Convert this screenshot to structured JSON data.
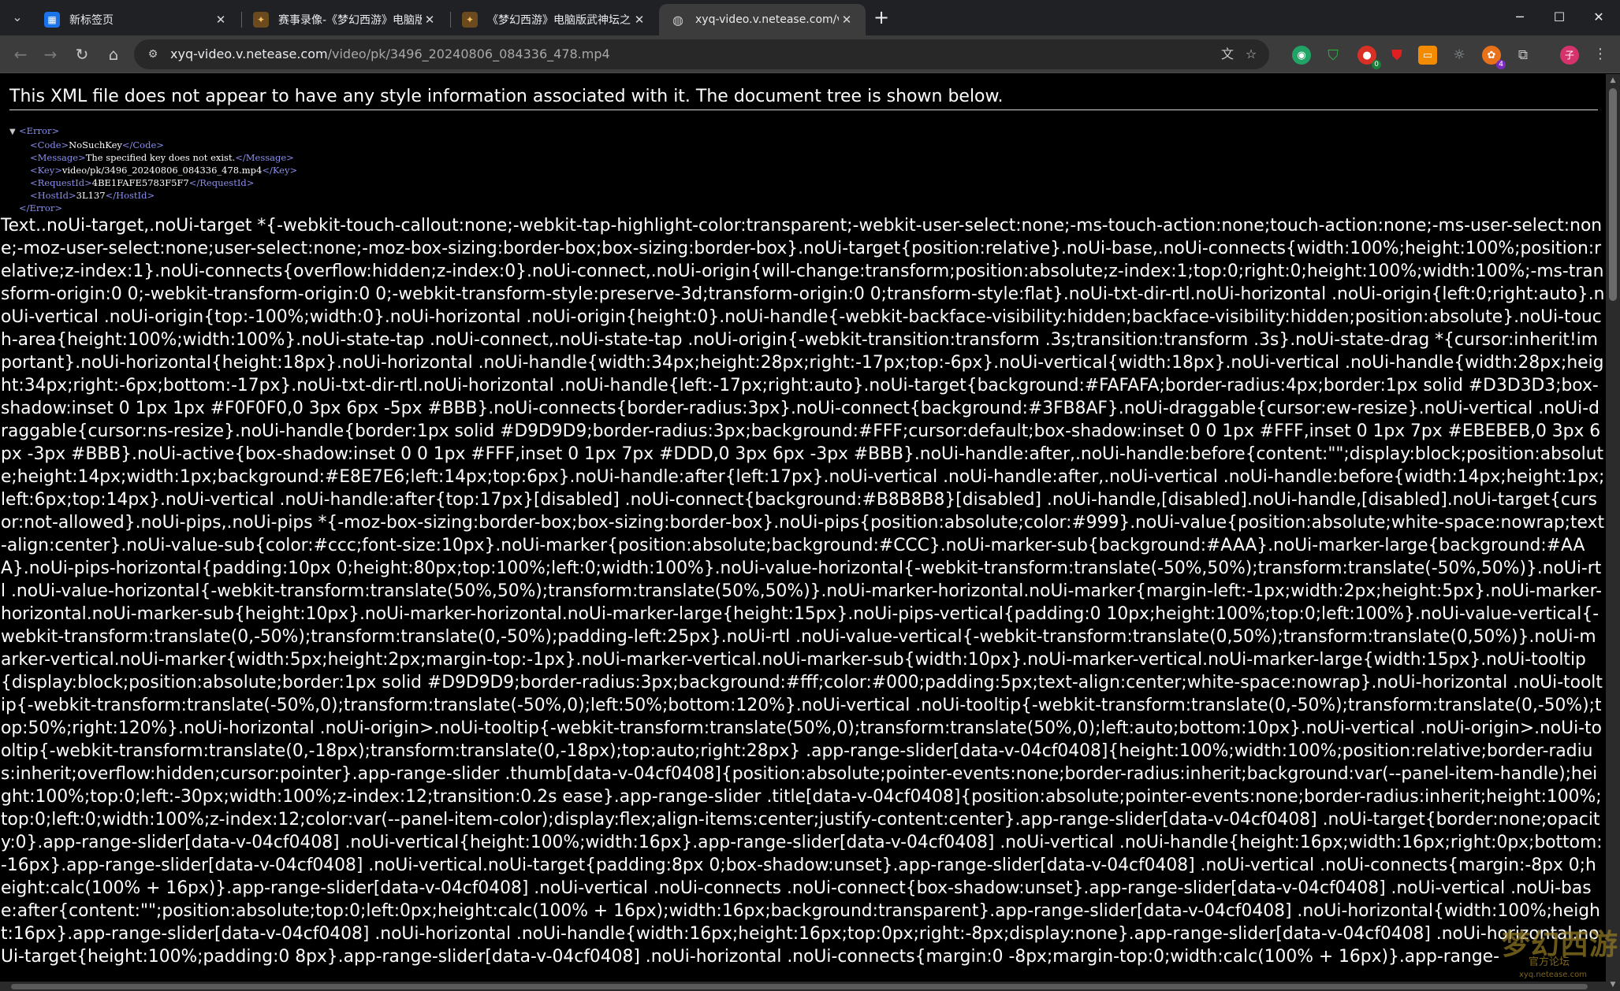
{
  "browser": {
    "tabs": [
      {
        "title": "新标签页",
        "favicon": "new-tab-icon",
        "favicon_color": "#1a73e8"
      },
      {
        "title": "赛事录像-《梦幻西游》电脑版",
        "favicon": "menghuan-icon",
        "favicon_color": "#e8a23a"
      },
      {
        "title": "《梦幻西游》电脑版武神坛之战",
        "favicon": "menghuan-icon",
        "favicon_color": "#e8a23a"
      },
      {
        "title": "xyq-video.v.netease.com/video",
        "favicon": "globe-icon",
        "favicon_color": "#9aa0a6"
      }
    ],
    "active_tab_index": 3,
    "address_bar": {
      "host": "xyq-video.v.netease.com",
      "path": "/video/pk/3496_20240806_084336_478.mp4"
    },
    "extensions": [
      {
        "name": "green-extension-icon",
        "color": "#21a366"
      },
      {
        "name": "shield-extension-icon",
        "color": "#2fb344"
      },
      {
        "name": "red-extension-icon",
        "color": "#d93025",
        "badge": "0"
      },
      {
        "name": "adblock-extension-icon",
        "color": "#e02020"
      },
      {
        "name": "orange-extension-icon",
        "color": "#f28b00"
      },
      {
        "name": "bulb-extension-icon",
        "color": "#9aa0a6"
      },
      {
        "name": "colorful-extension-icon",
        "color": "#e8711a",
        "badge": "4"
      },
      {
        "name": "puzzle-icon",
        "color": "#c8c8c8"
      }
    ]
  },
  "page": {
    "xml_notice": "This XML file does not appear to have any style information associated with it. The document tree is shown below.",
    "xml": {
      "root_open": "<Error>",
      "root_close": "</Error>",
      "children": [
        {
          "open": "<Code>",
          "value": "NoSuchKey",
          "close": "</Code>"
        },
        {
          "open": "<Message>",
          "value": "The specified key does not exist.",
          "close": "</Message>"
        },
        {
          "open": "<Key>",
          "value": "video/pk/3496_20240806_084336_478.mp4",
          "close": "</Key>"
        },
        {
          "open": "<RequestId>",
          "value": "4BE1FAFE5783F5F7",
          "close": "</RequestId>"
        },
        {
          "open": "<HostId>",
          "value": "3L137",
          "close": "</HostId>"
        }
      ]
    },
    "injected_css_text": "Text..noUi-target,.noUi-target *{-webkit-touch-callout:none;-webkit-tap-highlight-color:transparent;-webkit-user-select:none;-ms-touch-action:none;touch-action:none;-ms-user-select:none;-moz-user-select:none;user-select:none;-moz-box-sizing:border-box;box-sizing:border-box}.noUi-target{position:relative}.noUi-base,.noUi-connects{width:100%;height:100%;position:relative;z-index:1}.noUi-connects{overflow:hidden;z-index:0}.noUi-connect,.noUi-origin{will-change:transform;position:absolute;z-index:1;top:0;right:0;height:100%;width:100%;-ms-transform-origin:0 0;-webkit-transform-origin:0 0;-webkit-transform-style:preserve-3d;transform-origin:0 0;transform-style:flat}.noUi-txt-dir-rtl.noUi-horizontal .noUi-origin{left:0;right:auto}.noUi-vertical .noUi-origin{top:-100%;width:0}.noUi-horizontal .noUi-origin{height:0}.noUi-handle{-webkit-backface-visibility:hidden;backface-visibility:hidden;position:absolute}.noUi-touch-area{height:100%;width:100%}.noUi-state-tap .noUi-connect,.noUi-state-tap .noUi-origin{-webkit-transition:transform .3s;transition:transform .3s}.noUi-state-drag *{cursor:inherit!important}.noUi-horizontal{height:18px}.noUi-horizontal .noUi-handle{width:34px;height:28px;right:-17px;top:-6px}.noUi-vertical{width:18px}.noUi-vertical .noUi-handle{width:28px;height:34px;right:-6px;bottom:-17px}.noUi-txt-dir-rtl.noUi-horizontal .noUi-handle{left:-17px;right:auto}.noUi-target{background:#FAFAFA;border-radius:4px;border:1px solid #D3D3D3;box-shadow:inset 0 1px 1px #F0F0F0,0 3px 6px -5px #BBB}.noUi-connects{border-radius:3px}.noUi-connect{background:#3FB8AF}.noUi-draggable{cursor:ew-resize}.noUi-vertical .noUi-draggable{cursor:ns-resize}.noUi-handle{border:1px solid #D9D9D9;border-radius:3px;background:#FFF;cursor:default;box-shadow:inset 0 0 1px #FFF,inset 0 1px 7px #EBEBEB,0 3px 6px -3px #BBB}.noUi-active{box-shadow:inset 0 0 1px #FFF,inset 0 1px 7px #DDD,0 3px 6px -3px #BBB}.noUi-handle:after,.noUi-handle:before{content:\"\";display:block;position:absolute;height:14px;width:1px;background:#E8E7E6;left:14px;top:6px}.noUi-handle:after{left:17px}.noUi-vertical .noUi-handle:after,.noUi-vertical .noUi-handle:before{width:14px;height:1px;left:6px;top:14px}.noUi-vertical .noUi-handle:after{top:17px}[disabled] .noUi-connect{background:#B8B8B8}[disabled] .noUi-handle,[disabled].noUi-handle,[disabled].noUi-target{cursor:not-allowed}.noUi-pips,.noUi-pips *{-moz-box-sizing:border-box;box-sizing:border-box}.noUi-pips{position:absolute;color:#999}.noUi-value{position:absolute;white-space:nowrap;text-align:center}.noUi-value-sub{color:#ccc;font-size:10px}.noUi-marker{position:absolute;background:#CCC}.noUi-marker-sub{background:#AAA}.noUi-marker-large{background:#AAA}.noUi-pips-horizontal{padding:10px 0;height:80px;top:100%;left:0;width:100%}.noUi-value-horizontal{-webkit-transform:translate(-50%,50%);transform:translate(-50%,50%)}.noUi-rtl .noUi-value-horizontal{-webkit-transform:translate(50%,50%);transform:translate(50%,50%)}.noUi-marker-horizontal.noUi-marker{margin-left:-1px;width:2px;height:5px}.noUi-marker-horizontal.noUi-marker-sub{height:10px}.noUi-marker-horizontal.noUi-marker-large{height:15px}.noUi-pips-vertical{padding:0 10px;height:100%;top:0;left:100%}.noUi-value-vertical{-webkit-transform:translate(0,-50%);transform:translate(0,-50%);padding-left:25px}.noUi-rtl .noUi-value-vertical{-webkit-transform:translate(0,50%);transform:translate(0,50%)}.noUi-marker-vertical.noUi-marker{width:5px;height:2px;margin-top:-1px}.noUi-marker-vertical.noUi-marker-sub{width:10px}.noUi-marker-vertical.noUi-marker-large{width:15px}.noUi-tooltip{display:block;position:absolute;border:1px solid #D9D9D9;border-radius:3px;background:#fff;color:#000;padding:5px;text-align:center;white-space:nowrap}.noUi-horizontal .noUi-tooltip{-webkit-transform:translate(-50%,0);transform:translate(-50%,0);left:50%;bottom:120%}.noUi-vertical .noUi-tooltip{-webkit-transform:translate(0,-50%);transform:translate(0,-50%);top:50%;right:120%}.noUi-horizontal .noUi-origin>.noUi-tooltip{-webkit-transform:translate(50%,0);transform:translate(50%,0);left:auto;bottom:10px}.noUi-vertical .noUi-origin>.noUi-tooltip{-webkit-transform:translate(0,-18px);transform:translate(0,-18px);top:auto;right:28px} .app-range-slider[data-v-04cf0408]{height:100%;width:100%;position:relative;border-radius:inherit;overflow:hidden;cursor:pointer}.app-range-slider .thumb[data-v-04cf0408]{position:absolute;pointer-events:none;border-radius:inherit;background:var(--panel-item-handle);height:100%;top:0;left:-30px;width:100%;z-index:12;transition:0.2s ease}.app-range-slider .title[data-v-04cf0408]{position:absolute;pointer-events:none;border-radius:inherit;height:100%;top:0;left:0;width:100%;z-index:12;color:var(--panel-item-color);display:flex;align-items:center;justify-content:center}.app-range-slider[data-v-04cf0408] .noUi-target{border:none;opacity:0}.app-range-slider[data-v-04cf0408] .noUi-vertical{height:100%;width:16px}.app-range-slider[data-v-04cf0408] .noUi-vertical .noUi-handle{height:16px;width:16px;right:0px;bottom:-16px}.app-range-slider[data-v-04cf0408] .noUi-vertical.noUi-target{padding:8px 0;box-shadow:unset}.app-range-slider[data-v-04cf0408] .noUi-vertical .noUi-connects{margin:-8px 0;height:calc(100% + 16px)}.app-range-slider[data-v-04cf0408] .noUi-vertical .noUi-connects .noUi-connect{box-shadow:unset}.app-range-slider[data-v-04cf0408] .noUi-vertical .noUi-base:after{content:\"\";position:absolute;top:0;left:0px;height:calc(100% + 16px);width:16px;background:transparent}.app-range-slider[data-v-04cf0408] .noUi-horizontal{width:100%;height:16px}.app-range-slider[data-v-04cf0408] .noUi-horizontal .noUi-handle{width:16px;height:16px;top:0px;right:-8px;display:none}.app-range-slider[data-v-04cf0408] .noUi-horizontal.noUi-target{height:100%;padding:0 8px}.app-range-slider[data-v-04cf0408] .noUi-horizontal .noUi-connects{margin:0 -8px;margin-top:0;width:calc(100% + 16px)}.app-range-"
  },
  "watermark": {
    "title": "梦幻西游",
    "subtitle": "官方论坛",
    "url": "xyq.netease.com"
  }
}
